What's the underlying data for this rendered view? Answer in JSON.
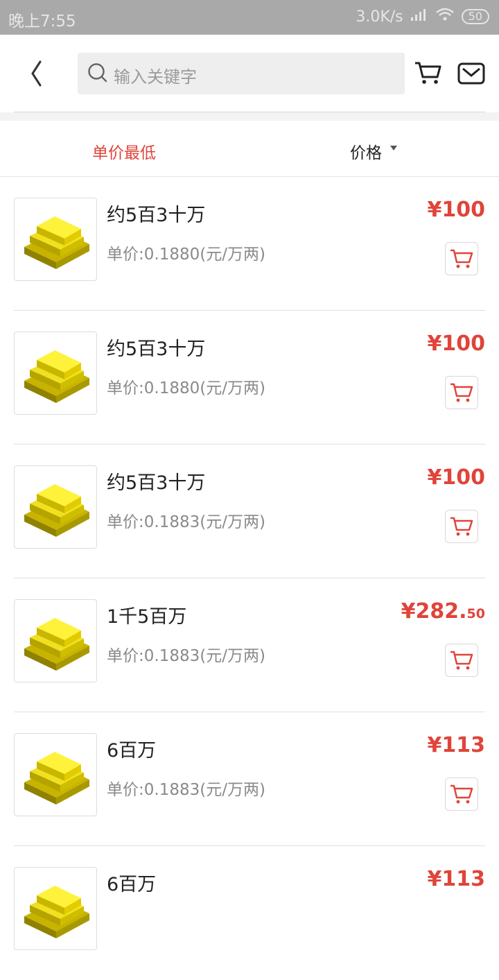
{
  "status_bar": {
    "time": "晚上7:55",
    "speed": "3.0K/s",
    "battery": "50"
  },
  "search": {
    "placeholder": "输入关键字"
  },
  "icons": {
    "back": "back-arrow-icon",
    "search": "search-icon",
    "cart": "shopping-cart-icon",
    "mail": "mail-icon"
  },
  "sort": {
    "unit_price_lowest": "单价最低",
    "price": "价格"
  },
  "colors": {
    "accent": "#e0443a",
    "status_bar": "#a9a9a9"
  },
  "items": [
    {
      "name": "约5百3十万",
      "unit_price": "单价:0.1880(元/万两)",
      "price_main": "¥100",
      "price_dec": ""
    },
    {
      "name": "约5百3十万",
      "unit_price": "单价:0.1880(元/万两)",
      "price_main": "¥100",
      "price_dec": ""
    },
    {
      "name": "约5百3十万",
      "unit_price": "单价:0.1883(元/万两)",
      "price_main": "¥100",
      "price_dec": ""
    },
    {
      "name": "1千5百万",
      "unit_price": "单价:0.1883(元/万两)",
      "price_main": "¥282.",
      "price_dec": "50"
    },
    {
      "name": "6百万",
      "unit_price": "单价:0.1883(元/万两)",
      "price_main": "¥113",
      "price_dec": ""
    },
    {
      "name": "6百万",
      "unit_price": "",
      "price_main": "¥113",
      "price_dec": ""
    }
  ]
}
